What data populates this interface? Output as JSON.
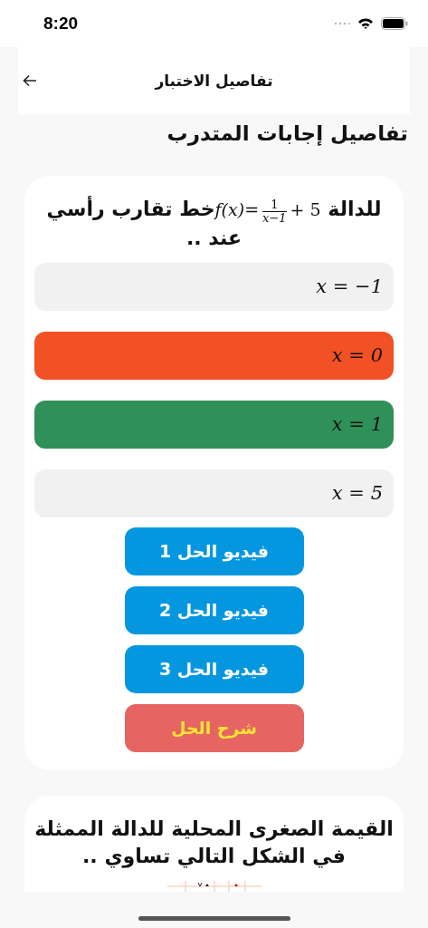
{
  "status_bar": {
    "time": "8:20"
  },
  "header": {
    "title": "تفاصيل الاختبار"
  },
  "page_title": "تفاصيل إجابات المتدرب",
  "questions": [
    {
      "text_before": "للدالة",
      "math": {
        "lhs": "f(x)=",
        "numerator": "1",
        "denominator": "x−1",
        "rhs": "+ 5"
      },
      "text_after": "خط تقارب رأسي عند ..",
      "options": [
        {
          "label": "x = −1",
          "selected": false,
          "correct": false
        },
        {
          "label": "x = 0",
          "selected": true,
          "correct": false
        },
        {
          "label": "x = 1",
          "selected": false,
          "correct": true
        },
        {
          "label": "x = 5",
          "selected": false,
          "correct": false
        }
      ],
      "buttons": [
        {
          "label": "فيديو الحل 1",
          "kind": "video"
        },
        {
          "label": "فيديو الحل 2",
          "kind": "video"
        },
        {
          "label": "فيديو الحل 3",
          "kind": "video"
        },
        {
          "label": "شرح الحل",
          "kind": "explanation"
        }
      ]
    },
    {
      "text_before": "القيمة الصغرى المحلية للدالة الممثلة في الشكل التالي تساوي ..",
      "figure": {
        "kind": "graph"
      }
    }
  ]
}
